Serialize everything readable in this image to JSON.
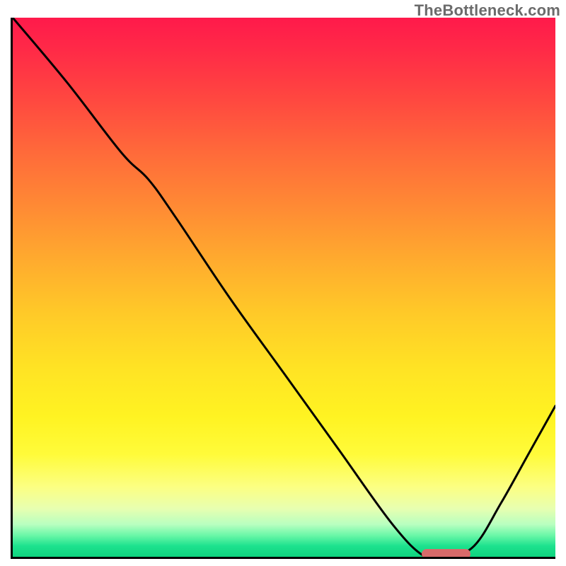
{
  "watermark": "TheBottleneck.com",
  "chart_data": {
    "type": "line",
    "title": "",
    "xlabel": "",
    "ylabel": "",
    "xlim": [
      0,
      100
    ],
    "ylim": [
      0,
      100
    ],
    "grid": false,
    "series": [
      {
        "name": "curve",
        "x": [
          0,
          10,
          20,
          25,
          30,
          40,
          50,
          60,
          70,
          76,
          80,
          85,
          90,
          95,
          100
        ],
        "values": [
          100,
          88,
          75,
          70,
          63,
          48,
          34,
          20,
          6,
          0,
          0,
          2,
          10,
          19,
          28
        ]
      }
    ],
    "optimal_range": {
      "x_start": 75,
      "x_end": 84,
      "y": 0.5
    },
    "colors": {
      "curve": "#000000",
      "marker": "#d86a6a",
      "gradient_top": "#ff1a4b",
      "gradient_bottom": "#0fd47f"
    }
  }
}
